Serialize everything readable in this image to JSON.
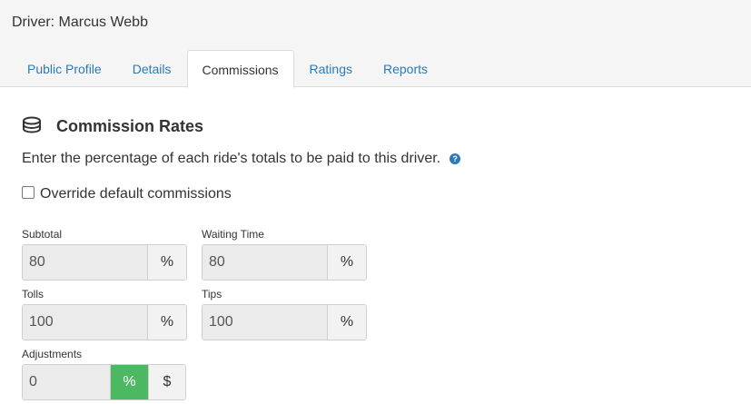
{
  "header": {
    "driver_title": "Driver: Marcus Webb",
    "tabs": [
      {
        "label": "Public Profile",
        "active": false
      },
      {
        "label": "Details",
        "active": false
      },
      {
        "label": "Commissions",
        "active": true
      },
      {
        "label": "Ratings",
        "active": false
      },
      {
        "label": "Reports",
        "active": false
      }
    ]
  },
  "section": {
    "icon": "coins-icon",
    "title": "Commission Rates",
    "description": "Enter the percentage of each ride's totals to be paid to this driver.",
    "help_icon": "?",
    "override_label": "Override default commissions",
    "override_checked": false
  },
  "fields": {
    "subtotal": {
      "label": "Subtotal",
      "value": "80",
      "unit": "%"
    },
    "waiting_time": {
      "label": "Waiting Time",
      "value": "80",
      "unit": "%"
    },
    "tolls": {
      "label": "Tolls",
      "value": "100",
      "unit": "%"
    },
    "tips": {
      "label": "Tips",
      "value": "100",
      "unit": "%"
    },
    "adjustments": {
      "label": "Adjustments",
      "value": "0",
      "percent_label": "%",
      "dollar_label": "$",
      "selected_unit": "%"
    }
  },
  "colors": {
    "link": "#2a7ab8",
    "active_toggle": "#4cb862",
    "disabled_input": "#ebebeb"
  }
}
